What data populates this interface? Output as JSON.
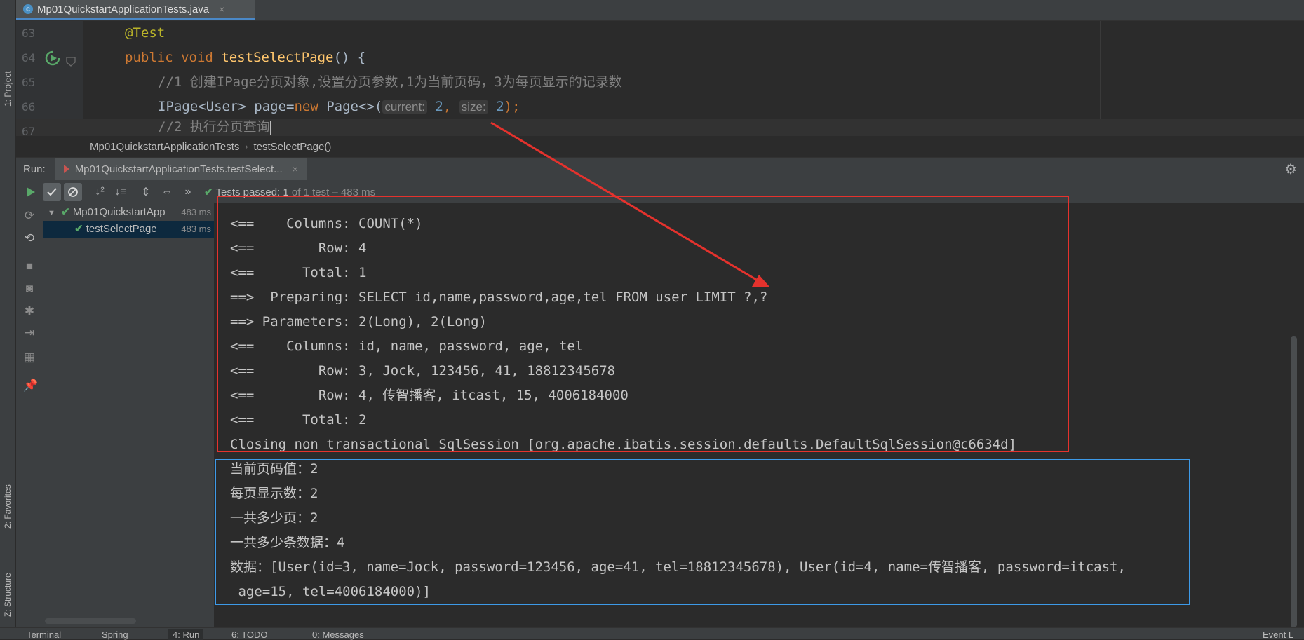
{
  "left_strip": {
    "project_tab": "1: Project",
    "favorites_tab": "2: Favorites",
    "structure_tab": "Z: Structure"
  },
  "editor": {
    "file_tab": "Mp01QuickstartApplicationTests.java",
    "lines": [
      {
        "num": "63"
      },
      {
        "num": "64"
      },
      {
        "num": "65"
      },
      {
        "num": "66"
      },
      {
        "num": "67"
      }
    ],
    "code": {
      "l63_annotation": "@Test",
      "l64_kw1": "public",
      "l64_kw2": "void",
      "l64_method": "testSelectPage",
      "l64_rest": "() {",
      "l65_comment": "//1 创建IPage分页对象,设置分页参数,1为当前页码，3为每页显示的记录数",
      "l66_part1": "IPage<User> page=",
      "l66_new": "new",
      "l66_part2": " Page<>(",
      "l66_hint1": "current:",
      "l66_val1": "2",
      "l66_comma": ",",
      "l66_hint2": "size:",
      "l66_val2": "2",
      "l66_end": ");",
      "l67_comment": "//2 执行分页查询"
    }
  },
  "breadcrumb": {
    "class_name": "Mp01QuickstartApplicationTests",
    "method_name": "testSelectPage()"
  },
  "run": {
    "label": "Run:",
    "config_tab": "Mp01QuickstartApplicationTests.testSelect...",
    "tests_passed_prefix": "Tests passed:",
    "tests_passed_count": "1",
    "tests_passed_suffix": "of 1 test – 483 ms"
  },
  "test_tree": {
    "root_name": "Mp01QuickstartApp",
    "root_duration": "483 ms",
    "child_name": "testSelectPage",
    "child_duration": "483 ms"
  },
  "console": {
    "sql_lines": [
      "<==    Columns: COUNT(*)",
      "<==        Row: 4",
      "<==      Total: 1",
      "==>  Preparing: SELECT id,name,password,age,tel FROM user LIMIT ?,?",
      "==> Parameters: 2(Long), 2(Long)",
      "<==    Columns: id, name, password, age, tel",
      "<==        Row: 3, Jock, 123456, 41, 18812345678",
      "<==        Row: 4, 传智播客, itcast, 15, 4006184000",
      "<==      Total: 2",
      "Closing non transactional SqlSession [org.apache.ibatis.session.defaults.DefaultSqlSession@c6634d]"
    ],
    "output_lines": [
      "当前页码值：2",
      "每页显示数：2",
      "一共多少页：2",
      "一共多少条数据：4",
      "数据：[User(id=3, name=Jock, password=123456, age=41, tel=18812345678), User(id=4, name=传智播客, password=itcast,",
      " age=15, tel=4006184000)]"
    ]
  },
  "bottom_bar": {
    "terminal": "Terminal",
    "spring": "Spring",
    "run": "4: Run",
    "todo": "6: TODO",
    "messages": "0: Messages",
    "event_log": "Event L"
  },
  "colors": {
    "sql_box_border": "#e5322d",
    "output_box_border": "#3d9ae8",
    "arrow": "#e5322d",
    "pass_green": "#59a869"
  }
}
